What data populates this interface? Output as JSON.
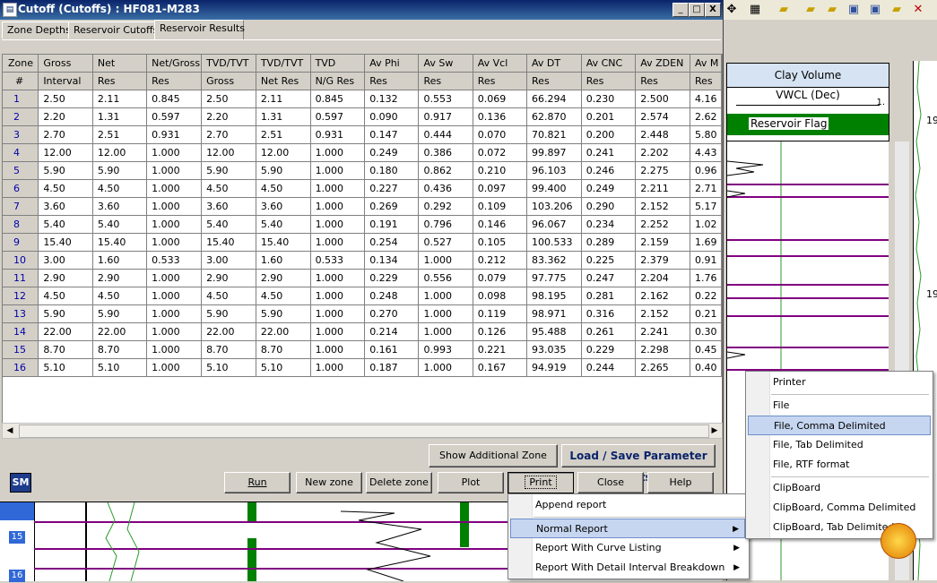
{
  "window": {
    "title": "Cutoff (Cutoffs) : HF081-M283",
    "app_icon": "document-icon",
    "controls": [
      "_",
      "□",
      "X"
    ]
  },
  "tabs": [
    {
      "label": "Zone Depths",
      "active": false
    },
    {
      "label": "Reservoir Cutoffs",
      "active": false
    },
    {
      "label": "Reservoir Results",
      "active": true
    }
  ],
  "grid": {
    "header1": [
      "Zone",
      "Gross",
      "Net",
      "Net/Gross",
      "TVD/TVT",
      "TVD/TVT",
      "TVD",
      "Av Phi",
      "Av Sw",
      "Av Vcl",
      "Av DT",
      "Av CNC",
      "Av ZDEN",
      "Av M"
    ],
    "header2": [
      "#",
      "Interval",
      "Res",
      "Res",
      "Gross",
      "Net Res",
      "N/G Res",
      "Res",
      "Res",
      "Res",
      "Res",
      "Res",
      "Res",
      "Res"
    ],
    "rows": [
      [
        "1",
        "2.50",
        "2.11",
        "0.845",
        "2.50",
        "2.11",
        "0.845",
        "0.132",
        "0.553",
        "0.069",
        "66.294",
        "0.230",
        "2.500",
        "4.16"
      ],
      [
        "2",
        "2.20",
        "1.31",
        "0.597",
        "2.20",
        "1.31",
        "0.597",
        "0.090",
        "0.917",
        "0.136",
        "62.870",
        "0.201",
        "2.574",
        "2.62"
      ],
      [
        "3",
        "2.70",
        "2.51",
        "0.931",
        "2.70",
        "2.51",
        "0.931",
        "0.147",
        "0.444",
        "0.070",
        "70.821",
        "0.200",
        "2.448",
        "5.80"
      ],
      [
        "4",
        "12.00",
        "12.00",
        "1.000",
        "12.00",
        "12.00",
        "1.000",
        "0.249",
        "0.386",
        "0.072",
        "99.897",
        "0.241",
        "2.202",
        "4.43"
      ],
      [
        "5",
        "5.90",
        "5.90",
        "1.000",
        "5.90",
        "5.90",
        "1.000",
        "0.180",
        "0.862",
        "0.210",
        "96.103",
        "0.246",
        "2.275",
        "0.96"
      ],
      [
        "6",
        "4.50",
        "4.50",
        "1.000",
        "4.50",
        "4.50",
        "1.000",
        "0.227",
        "0.436",
        "0.097",
        "99.400",
        "0.249",
        "2.211",
        "2.71"
      ],
      [
        "7",
        "3.60",
        "3.60",
        "1.000",
        "3.60",
        "3.60",
        "1.000",
        "0.269",
        "0.292",
        "0.109",
        "103.206",
        "0.290",
        "2.152",
        "5.17"
      ],
      [
        "8",
        "5.40",
        "5.40",
        "1.000",
        "5.40",
        "5.40",
        "1.000",
        "0.191",
        "0.796",
        "0.146",
        "96.067",
        "0.234",
        "2.252",
        "1.02"
      ],
      [
        "9",
        "15.40",
        "15.40",
        "1.000",
        "15.40",
        "15.40",
        "1.000",
        "0.254",
        "0.527",
        "0.105",
        "100.533",
        "0.289",
        "2.159",
        "1.69"
      ],
      [
        "10",
        "3.00",
        "1.60",
        "0.533",
        "3.00",
        "1.60",
        "0.533",
        "0.134",
        "1.000",
        "0.212",
        "83.362",
        "0.225",
        "2.379",
        "0.91"
      ],
      [
        "11",
        "2.90",
        "2.90",
        "1.000",
        "2.90",
        "2.90",
        "1.000",
        "0.229",
        "0.556",
        "0.079",
        "97.775",
        "0.247",
        "2.204",
        "1.76"
      ],
      [
        "12",
        "4.50",
        "4.50",
        "1.000",
        "4.50",
        "4.50",
        "1.000",
        "0.248",
        "1.000",
        "0.098",
        "98.195",
        "0.281",
        "2.162",
        "0.22"
      ],
      [
        "13",
        "5.90",
        "5.90",
        "1.000",
        "5.90",
        "5.90",
        "1.000",
        "0.270",
        "1.000",
        "0.119",
        "98.971",
        "0.316",
        "2.152",
        "0.21"
      ],
      [
        "14",
        "22.00",
        "22.00",
        "1.000",
        "22.00",
        "22.00",
        "1.000",
        "0.214",
        "1.000",
        "0.126",
        "95.488",
        "0.261",
        "2.241",
        "0.30"
      ],
      [
        "15",
        "8.70",
        "8.70",
        "1.000",
        "8.70",
        "8.70",
        "1.000",
        "0.161",
        "0.993",
        "0.221",
        "93.035",
        "0.229",
        "2.298",
        "0.45"
      ],
      [
        "16",
        "5.10",
        "5.10",
        "1.000",
        "5.10",
        "5.10",
        "1.000",
        "0.187",
        "1.000",
        "0.167",
        "94.919",
        "0.244",
        "2.265",
        "0.40"
      ]
    ]
  },
  "buttons": {
    "show_additional": "Show Additional Zone Info",
    "load_save": "Load / Save Parameter Sets",
    "run": "Run",
    "new_zone": "New zone",
    "delete_zone": "Delete zone",
    "plot": "Plot",
    "print": "Print",
    "close": "Close",
    "help": "Help"
  },
  "logo": "SM",
  "print_menu": {
    "items": [
      "Append report",
      "Normal Report",
      "Report With Curve Listing",
      "Report With Detail Interval Breakdown"
    ],
    "highlighted": "Normal Report"
  },
  "normal_report_submenu": {
    "items": [
      "Printer",
      "File",
      "File, Comma Delimited",
      "File, Tab Delimited",
      "File, RTF format",
      "ClipBoard",
      "ClipBoard, Comma Delimited",
      "ClipBoard, Tab Delimited"
    ],
    "highlighted": "File, Comma Delimited"
  },
  "log_track": {
    "curve_name": "Clay Volume",
    "curve_mnemonic": "VWCL (Dec)",
    "scale_right": "1.",
    "flag_name": "Reservoir Flag",
    "depth_label_1": "19",
    "depth_label_2": "19"
  },
  "bottom_strip": {
    "zone_labels": [
      "15",
      "16"
    ]
  },
  "colors": {
    "titlebar": "#0a246a",
    "flag_green": "#008000",
    "zone_line_purple": "#800080",
    "menu_highlight": "#c6d6f0"
  }
}
